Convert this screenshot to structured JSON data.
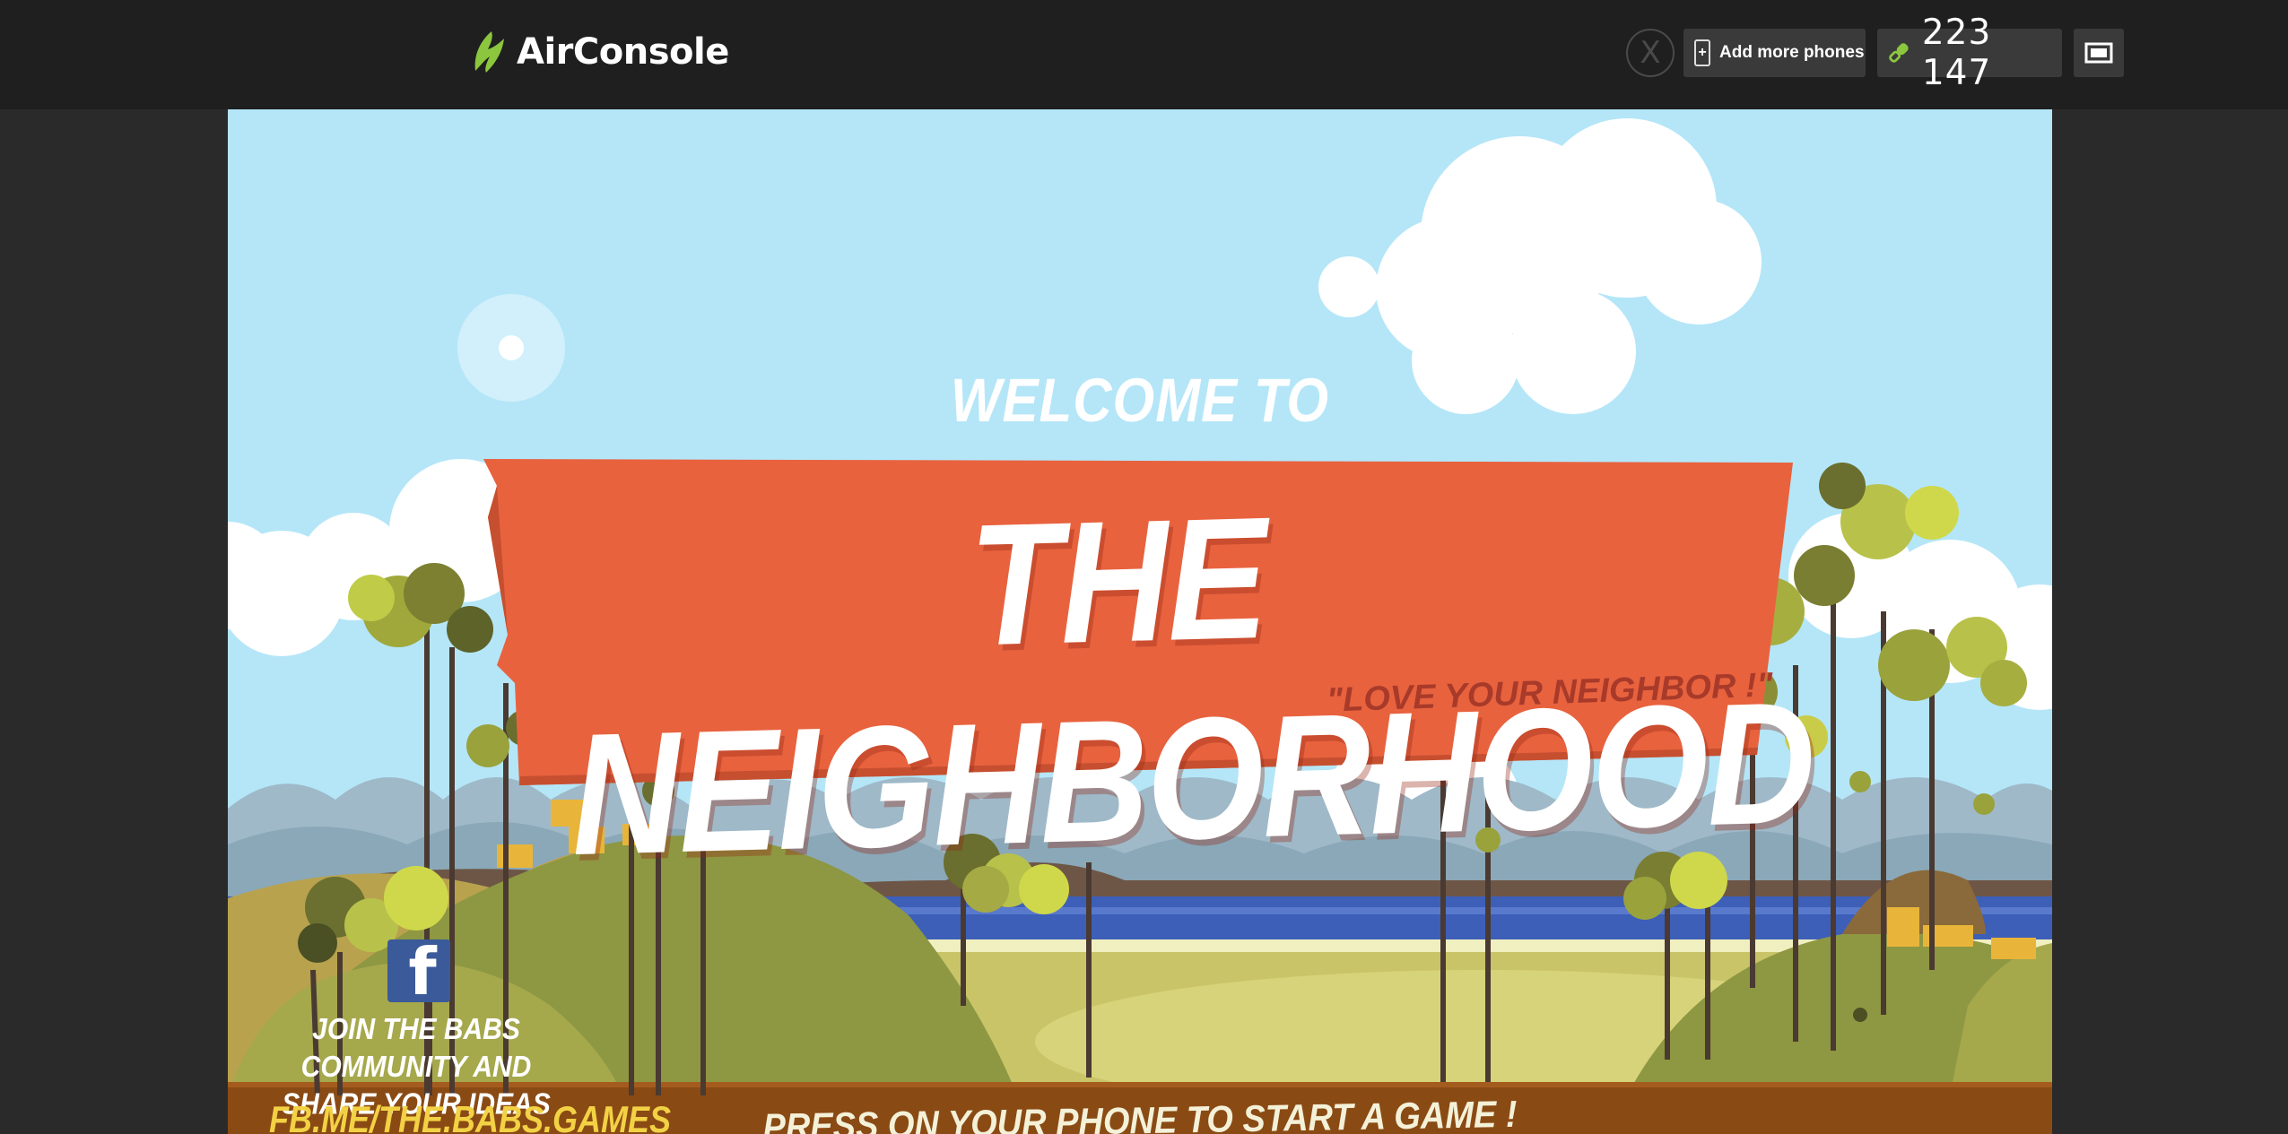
{
  "topbar": {
    "logo_text": "AirConsole",
    "exit_label": "X",
    "add_phones_label": "Add more phones",
    "code": "223 147"
  },
  "game": {
    "welcome": "WELCOME TO",
    "title": "THE NEIGHBORHOOD",
    "slogan": "\"LOVE YOUR NEIGHBOR !\"",
    "press_prompt": "PRESS ON YOUR PHONE TO START A GAME !",
    "community_line1": "JOIN THE BABS COMMUNITY AND",
    "community_line2": "SHARE YOUR IDEAS",
    "fb_link": "FB.ME/THE.BABS.GAMES"
  },
  "colors": {
    "accent_green": "#8cc63f",
    "sign_orange": "#e8623e",
    "sky": "#b4e6f8"
  }
}
